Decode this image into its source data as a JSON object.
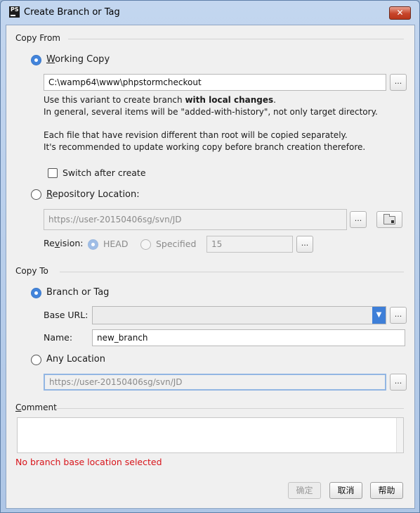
{
  "window": {
    "title": "Create Branch or Tag",
    "app_icon_text": "PS",
    "close_glyph": "✕"
  },
  "copy_from": {
    "section_label": "Copy From",
    "working_copy": {
      "label_first": "W",
      "label_rest": "orking Copy",
      "selected": true,
      "path_value": "C:\\wamp64\\www\\phpstormcheckout",
      "browse_label": "...",
      "desc_line1_prefix": "Use this variant to create branch ",
      "desc_line1_bold": "with local changes",
      "desc_line1_suffix": ".",
      "desc_line2": "In general, several items will be \"added-with-history\", not only target directory.",
      "desc_line3": "Each file that have revision different than root will be copied separately.",
      "desc_line4": "It's recommended to update working copy before branch creation therefore.",
      "switch_after_create_label": "Switch after create",
      "switch_after_create_checked": false
    },
    "repository_location": {
      "label_first": "R",
      "label_rest": "epository Location:",
      "selected": false,
      "url_value": "https://user-20150406sg/svn/JD",
      "browse_label": "...",
      "folder_button_icon": "folder-icon",
      "revision_label_pre": "Re",
      "revision_label_u": "v",
      "revision_label_post": "ision:",
      "head_label": "HEAD",
      "specified_label": "Specified",
      "revision_value": "15",
      "revision_browse_label": "..."
    }
  },
  "copy_to": {
    "section_label": "Copy To",
    "branch_or_tag": {
      "label": "Branch or Tag",
      "selected": true,
      "base_url_label": "Base URL:",
      "base_url_value": "",
      "base_url_browse_label": "...",
      "name_label": "Name:",
      "name_value": "new_branch"
    },
    "any_location": {
      "label": "Any Location",
      "selected": false,
      "url_value": "https://user-20150406sg/svn/JD",
      "browse_label": "..."
    }
  },
  "comment": {
    "label_first": "C",
    "label_rest": "omment",
    "value": ""
  },
  "error_message": "No branch base location selected",
  "buttons": {
    "ok": "确定",
    "cancel": "取消",
    "help": "帮助"
  },
  "colors": {
    "accent": "#4284db",
    "error": "#d8141a"
  }
}
